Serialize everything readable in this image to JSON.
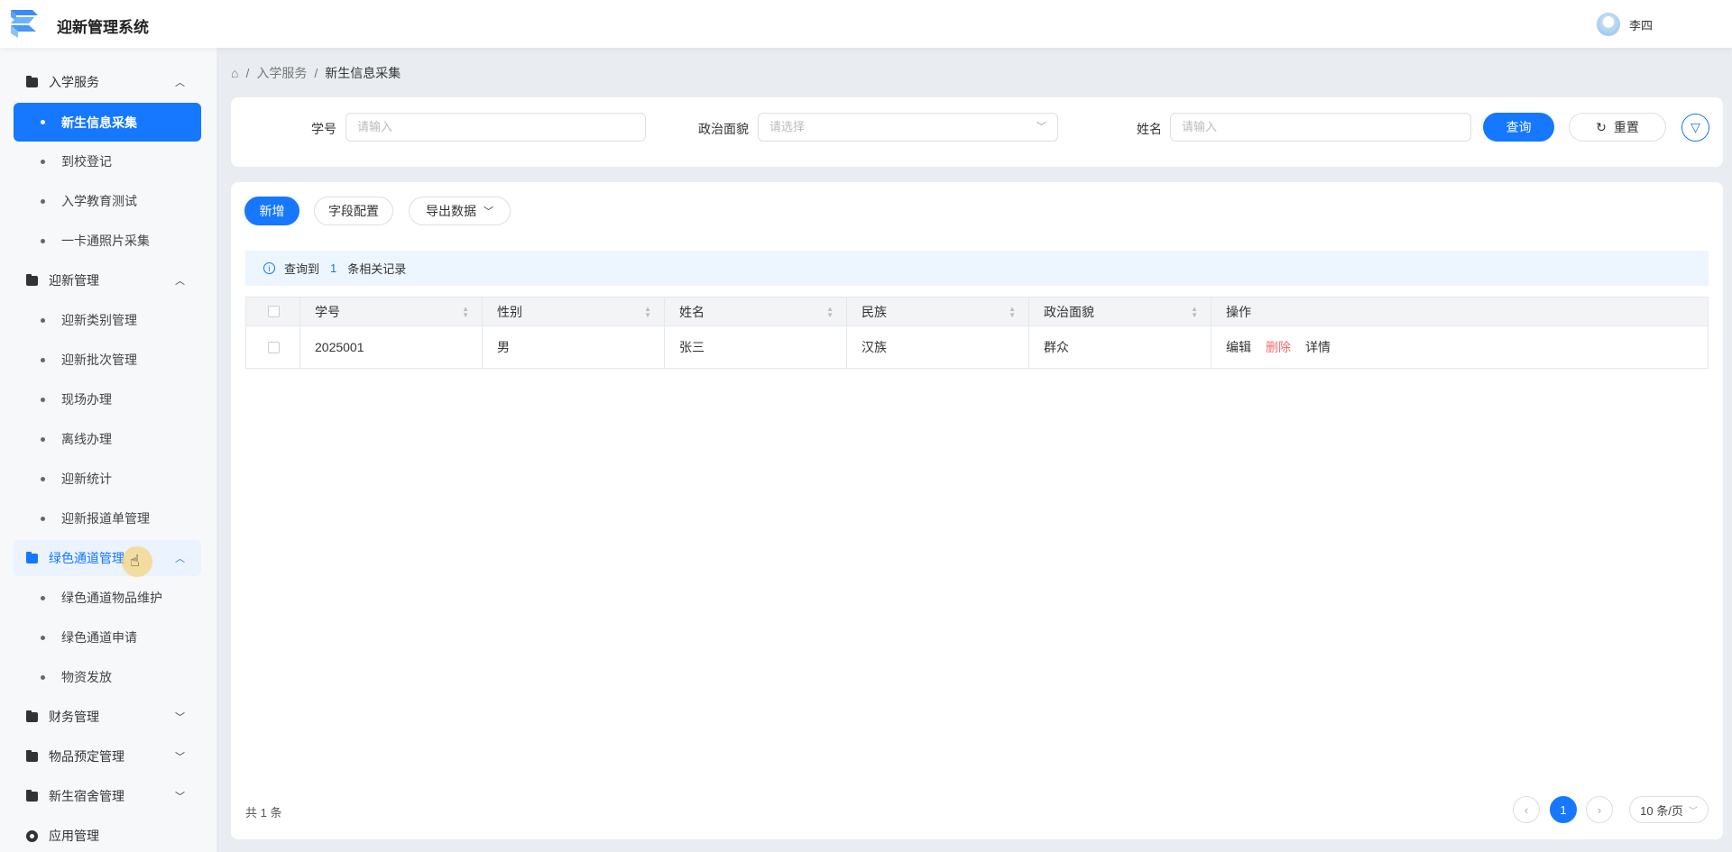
{
  "header": {
    "title": "迎新管理系统",
    "user": "李四"
  },
  "sidebar": {
    "groups": [
      {
        "label": "入学服务",
        "expanded": true,
        "items": [
          "新生信息采集",
          "到校登记",
          "入学教育测试",
          "一卡通照片采集"
        ]
      },
      {
        "label": "迎新管理",
        "expanded": true,
        "items": [
          "迎新类别管理",
          "迎新批次管理",
          "现场办理",
          "离线办理",
          "迎新统计",
          "迎新报道单管理"
        ]
      },
      {
        "label": "绿色通道管理",
        "expanded": true,
        "items": [
          "绿色通道物品维护",
          "绿色通道申请",
          "物资发放"
        ]
      },
      {
        "label": "财务管理",
        "expanded": false
      },
      {
        "label": "物品预定管理",
        "expanded": false
      },
      {
        "label": "新生宿舍管理",
        "expanded": false
      },
      {
        "label": "应用管理"
      }
    ],
    "active_item": "新生信息采集"
  },
  "breadcrumb": [
    "入学服务",
    "新生信息采集"
  ],
  "search": {
    "student_id_label": "学号",
    "student_id_placeholder": "请输入",
    "political_label": "政治面貌",
    "political_placeholder": "请选择",
    "name_label": "姓名",
    "name_placeholder": "请输入",
    "query": "查询",
    "reset": "重置"
  },
  "toolbar": {
    "add": "新增",
    "field_config": "字段配置",
    "export": "导出数据"
  },
  "alert": {
    "prefix": "查询到",
    "count": "1",
    "suffix": "条相关记录"
  },
  "table": {
    "columns": [
      "学号",
      "性别",
      "姓名",
      "民族",
      "政治面貌",
      "操作"
    ],
    "rows": [
      {
        "id": "2025001",
        "gender": "男",
        "name": "张三",
        "ethnicity": "汉族",
        "political": "群众"
      }
    ],
    "actions": {
      "edit": "编辑",
      "delete": "删除",
      "detail": "详情"
    }
  },
  "pagination": {
    "total": "共 1 条",
    "current": "1",
    "page_size": "10 条/页"
  },
  "colors": {
    "primary": "#1677ff",
    "danger": "#f56c6c"
  }
}
